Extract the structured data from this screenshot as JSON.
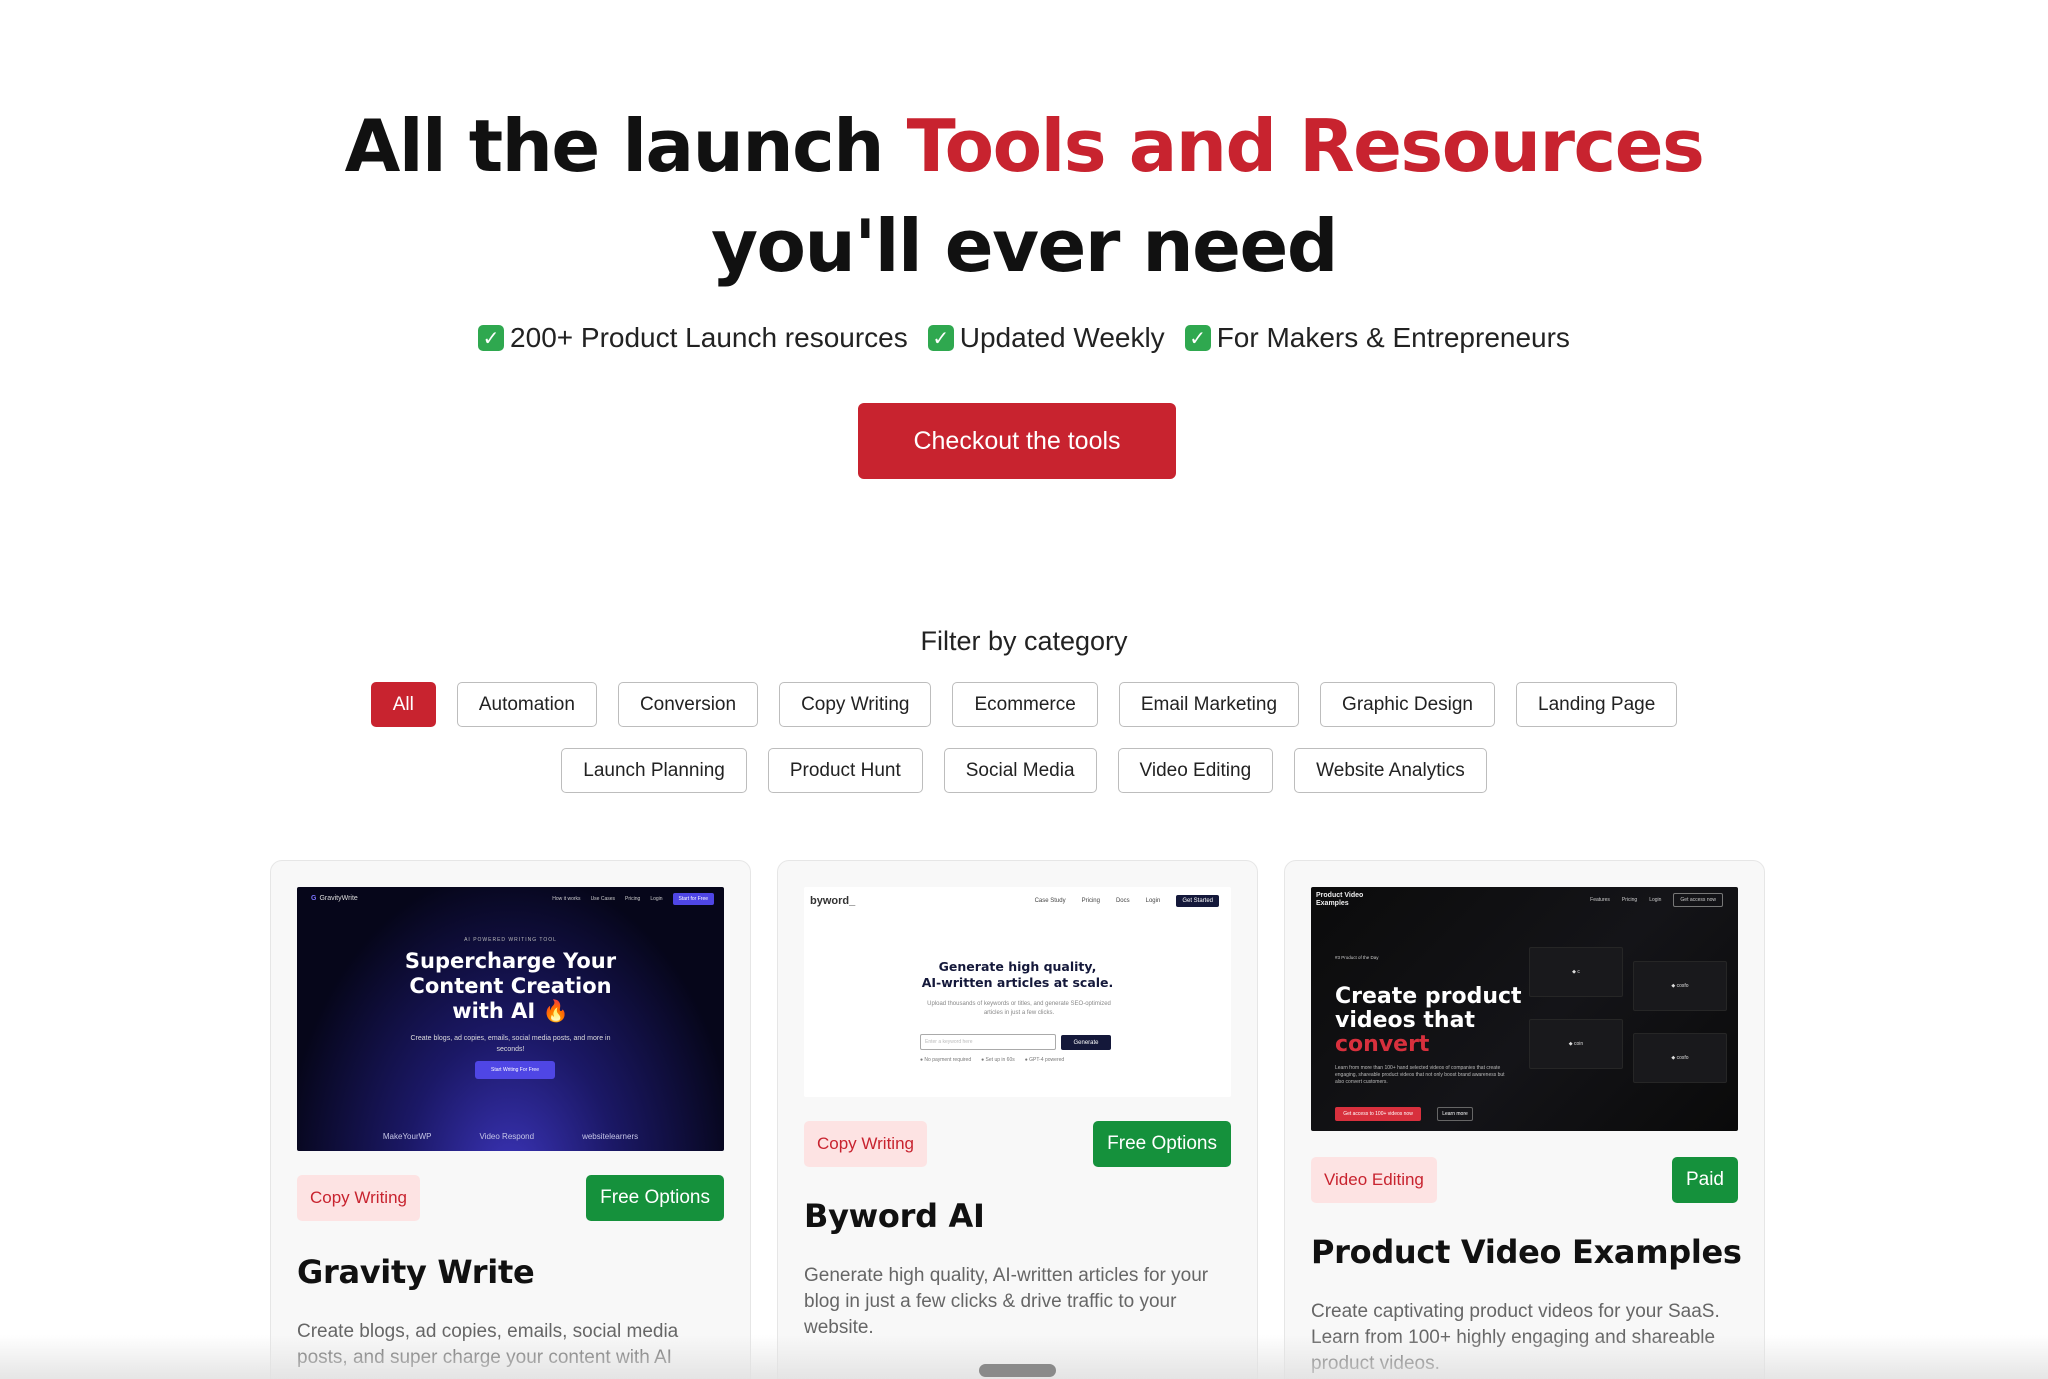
{
  "hero": {
    "title_part1": "All the launch ",
    "title_accent": "Tools and Resources",
    "title_line2": "you'll ever need",
    "checks": [
      "200+ Product Launch resources",
      "Updated Weekly",
      "For Makers & Entrepreneurs"
    ],
    "cta_label": "Checkout the tools"
  },
  "filter": {
    "title": "Filter by category",
    "row1": [
      "All",
      "Automation",
      "Conversion",
      "Copy Writing",
      "Ecommerce",
      "Email Marketing",
      "Graphic Design",
      "Landing Page"
    ],
    "row2": [
      "Launch Planning",
      "Product Hunt",
      "Social Media",
      "Video Editing",
      "Website Analytics"
    ],
    "active": "All"
  },
  "cards": [
    {
      "category": "Copy Writing",
      "pricing": "Free Options",
      "title": "Gravity Write",
      "description": "Create blogs, ad copies, emails, social media posts, and super charge your content with AI",
      "thumb": {
        "brand": "GravityWrite",
        "nav": [
          "How it works",
          "Use Cases",
          "Pricing",
          "Login"
        ],
        "nav_button": "Start for Free",
        "eyebrow": "AI POWERED WRITING TOOL",
        "headline": "Supercharge Your Content Creation with AI 🔥",
        "sub": "Create blogs, ad copies, emails, social media posts, and more in seconds!",
        "button": "Start Writing For Free",
        "logos": [
          "MakeYourWP",
          "Video Respond",
          "websitelearners"
        ]
      }
    },
    {
      "category": "Copy Writing",
      "pricing": "Free Options",
      "title": "Byword AI",
      "description": "Generate high quality, AI-written articles for your blog in just a few clicks & drive traffic to your website.",
      "thumb": {
        "logo": "byword_",
        "nav": [
          "Case Study",
          "Pricing",
          "Docs",
          "Login"
        ],
        "nav_button": "Get Started",
        "headline_1": "Generate high quality,",
        "headline_2": "AI-written articles at scale.",
        "sub": "Upload thousands of keywords or titles, and generate SEO-optimized articles in just a few clicks.",
        "input_placeholder": "Enter a keyword here",
        "button": "Generate",
        "ticks": [
          "No payment required",
          "Set up in 60s",
          "GPT-4 powered"
        ]
      }
    },
    {
      "category": "Video Editing",
      "pricing": "Paid",
      "title": "Product Video Examples",
      "description": "Create captivating product videos for your SaaS. Learn from 100+ highly engaging and shareable product videos.",
      "thumb": {
        "logo_1": "Product Video",
        "logo_2": "Examples",
        "nav": [
          "Features",
          "Pricing",
          "Login"
        ],
        "nav_button": "Get access now",
        "pill": "#3 Product of the Day",
        "headline_1": "Create product",
        "headline_2": "videos that",
        "headline_3": "convert",
        "sub": "Learn from more than 100+ hand selected videos of companies that create engaging, shareable product videos that not only boost brand awareness but also convert customers.",
        "button_1": "Get access to 100+ videos now",
        "button_2": "Learn more",
        "tiles": [
          "◆ c",
          "◆ cosfo",
          "◆ coin",
          "◆ cosfo"
        ]
      }
    }
  ],
  "colors": {
    "accent": "#c8232f",
    "pricing_green": "#15913c",
    "tag_bg": "#fde3e3"
  }
}
